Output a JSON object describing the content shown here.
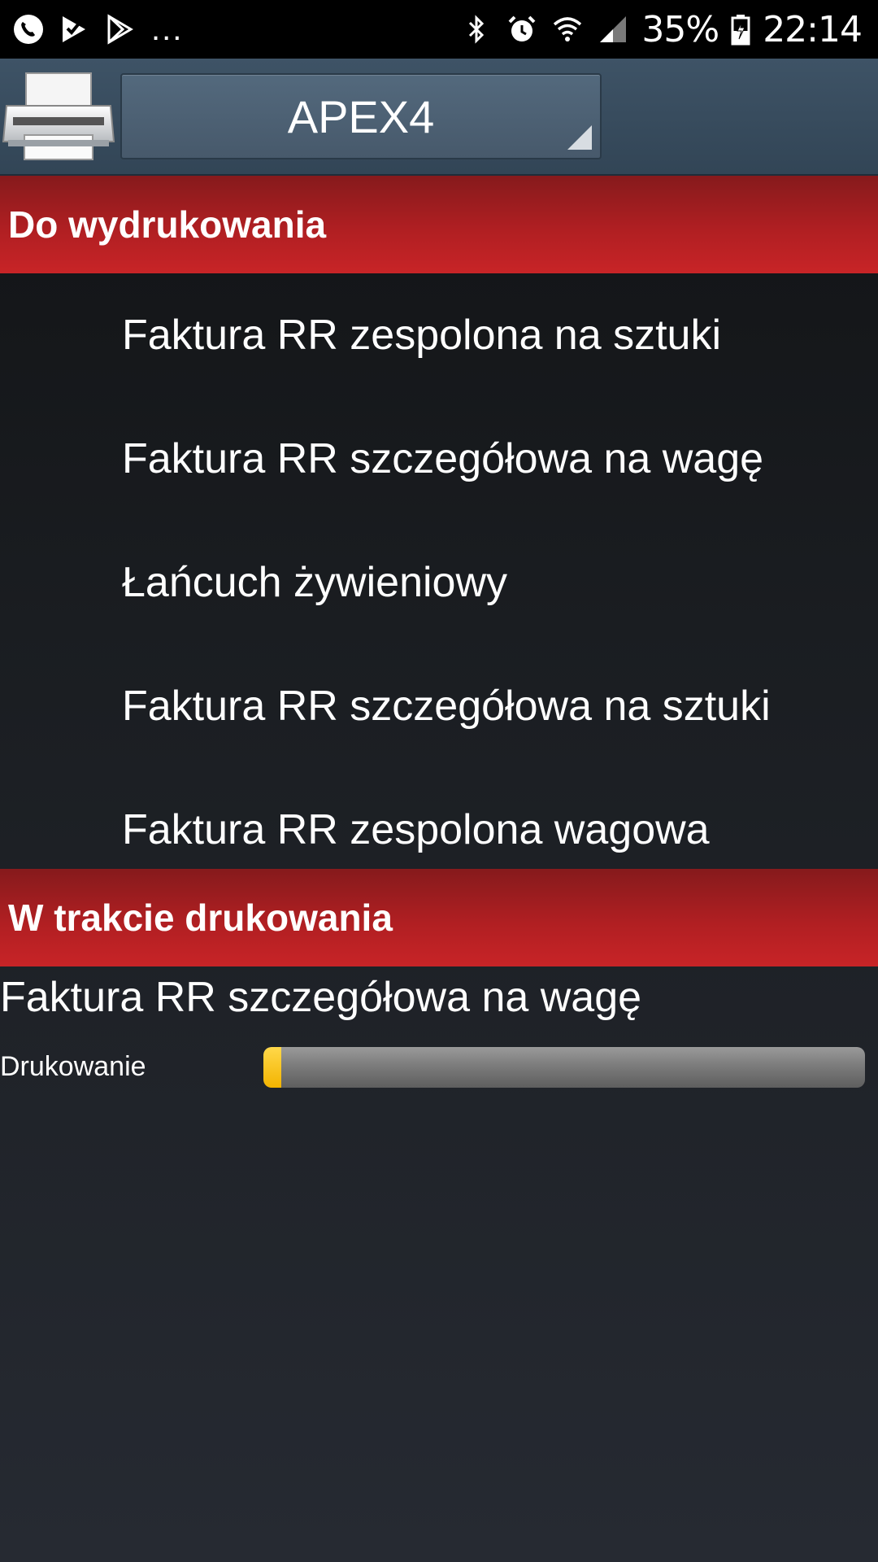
{
  "status_bar": {
    "left_icons": [
      "phone-call-icon",
      "check-download-icon",
      "play-store-icon"
    ],
    "more": "...",
    "right_icons": [
      "bluetooth-icon",
      "alarm-icon",
      "wifi-icon",
      "cell-signal-icon",
      "battery-charging-icon"
    ],
    "battery": "35%",
    "time": "22:14"
  },
  "toolbar": {
    "printer_icon": "printer-icon",
    "selected_printer": "APEX4"
  },
  "sections": {
    "pending_title": "Do wydrukowania",
    "printing_title": "W trakcie drukowania"
  },
  "pending_items": [
    "Faktura RR zespolona na sztuki",
    "Faktura RR szczegółowa na wagę",
    "Łańcuch żywieniowy",
    "Faktura RR szczegółowa na sztuki",
    "Faktura RR zespolona wagowa"
  ],
  "printing_job": {
    "title": "Faktura RR szczegółowa na wagę",
    "status": "Drukowanie",
    "progress": 0.03
  },
  "colors": {
    "header_red": "#c82427",
    "toolbar_blue": "#3e5366",
    "progress_yellow": "#f3b400"
  }
}
